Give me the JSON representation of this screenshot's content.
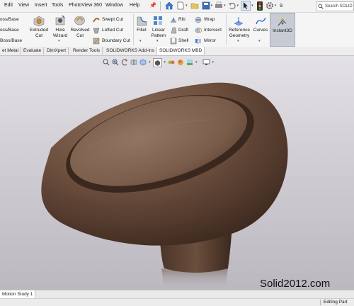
{
  "menu": {
    "items": [
      "Edit",
      "View",
      "Insert",
      "Tools",
      "PhotoView 360",
      "Window",
      "Help"
    ]
  },
  "quick_access": {
    "icons": [
      "pin-icon",
      "home-icon",
      "open-folder-icon",
      "new-doc-icon",
      "save-icon",
      "print-icon",
      "undo-icon",
      "select-arrow-icon",
      "traffic-light-icon",
      "options-gear-icon"
    ],
    "zoom_value": "9"
  },
  "search": {
    "placeholder": "Search SOLID"
  },
  "ribbon": {
    "boss_base_items": [
      "oss/Base",
      "oss/Base",
      "Boss/Base"
    ],
    "extruded_cut": [
      "Extruded",
      "Cut"
    ],
    "hole_wizard": [
      "Hole",
      "Wizard"
    ],
    "revolved_cut": [
      "Revolved",
      "Cut"
    ],
    "swept_cut": "Swept Cut",
    "lofted_cut": "Lofted Cut",
    "boundary_cut": "Boundary Cut",
    "fillet": "Fillet",
    "linear_pattern": [
      "Linear",
      "Pattern"
    ],
    "rib": "Rib",
    "draft": "Draft",
    "shell": "Shell",
    "wrap": "Wrap",
    "intersect": "Intersect",
    "mirror": "Mirror",
    "reference_geometry": [
      "Reference",
      "Geometry"
    ],
    "curves": "Curves",
    "instant3d": "Instant3D"
  },
  "tabs": [
    "et Metal",
    "Evaluate",
    "DimXpert",
    "Render Tools",
    "SOLIDWORKS Add-Ins",
    "SOLIDWORKS MBD"
  ],
  "viewport": {
    "hud_icons": [
      "zoom-to-fit-icon",
      "zoom-area-icon",
      "previous-view-icon",
      "section-view-icon",
      "view-orientation-icon",
      "display-style-icon",
      "hide-show-icon",
      "edit-appearance-icon",
      "scene-icon",
      "view-settings-icon"
    ],
    "watermark": "Solid2012.com",
    "model_colors": {
      "leather_light": "#8a6a55",
      "leather_dark": "#4a3327",
      "background_top": "#e4e1e6",
      "background_bottom": "#bcb8c0"
    }
  },
  "bottom": {
    "motion_tab": "Motion Study 1",
    "status": "Editing Part"
  }
}
